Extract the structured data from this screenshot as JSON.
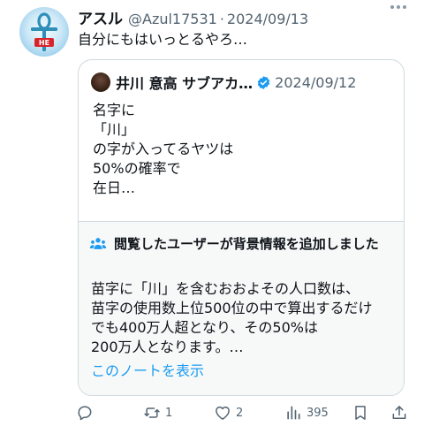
{
  "tweet": {
    "author_name": "アスル",
    "handle": "@Azul17531",
    "separator": "·",
    "date": "2024/09/13",
    "text": "自分にもはいっとるやろ…",
    "avatar_text": "HE"
  },
  "quote": {
    "author_name": "井川 意高 サブアカ…",
    "date": "2024/09/12",
    "body": "名字に\n「川」\nの字が入ってるヤツは\n50%の確率で\n在日…"
  },
  "note": {
    "title": "閲覧したユーザーが背景情報を追加しました",
    "body": "苗字に「川」を含むおおよその人口数は、\n苗字の使用数上位500位の中で算出するだけ\nでも400万人超となり、その50%は\n200万人となります。…",
    "link": "このノートを表示"
  },
  "actions": {
    "replies": "",
    "retweets": "1",
    "likes": "2",
    "views": "395"
  },
  "colors": {
    "text": "#0f1419",
    "secondary": "#536471",
    "link": "#1d9bf0",
    "border": "#cfd9de",
    "note_bg": "#f7f9f9"
  }
}
